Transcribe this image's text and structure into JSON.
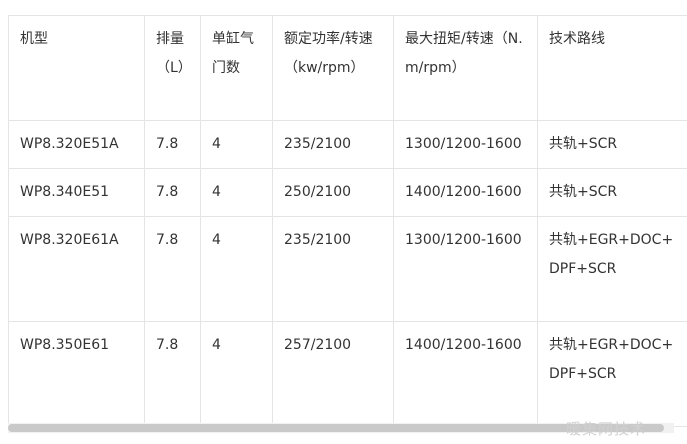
{
  "table": {
    "headers": [
      "机型",
      "排量（L）",
      "单缸气门数",
      "额定功率/转速（kw/rpm）",
      "最大扭矩/转速（N.m/rpm）",
      "技术路线"
    ],
    "rows": [
      [
        "WP8.320E51A",
        "7.8",
        "4",
        "235/2100",
        "1300/1200-1600",
        "共轨+SCR"
      ],
      [
        "WP8.340E51",
        "7.8",
        "4",
        "250/2100",
        "1400/1200-1600",
        "共轨+SCR"
      ],
      [
        "WP8.320E61A",
        "7.8",
        "4",
        "235/2100",
        "1300/1200-1600",
        "共轨+EGR+DOC+DPF+SCR"
      ],
      [
        "WP8.350E61",
        "7.8",
        "4",
        "257/2100",
        "1400/1200-1600",
        "共轨+EGR+DOC+DPF+SCR"
      ]
    ]
  },
  "watermark": "暖集网技术"
}
